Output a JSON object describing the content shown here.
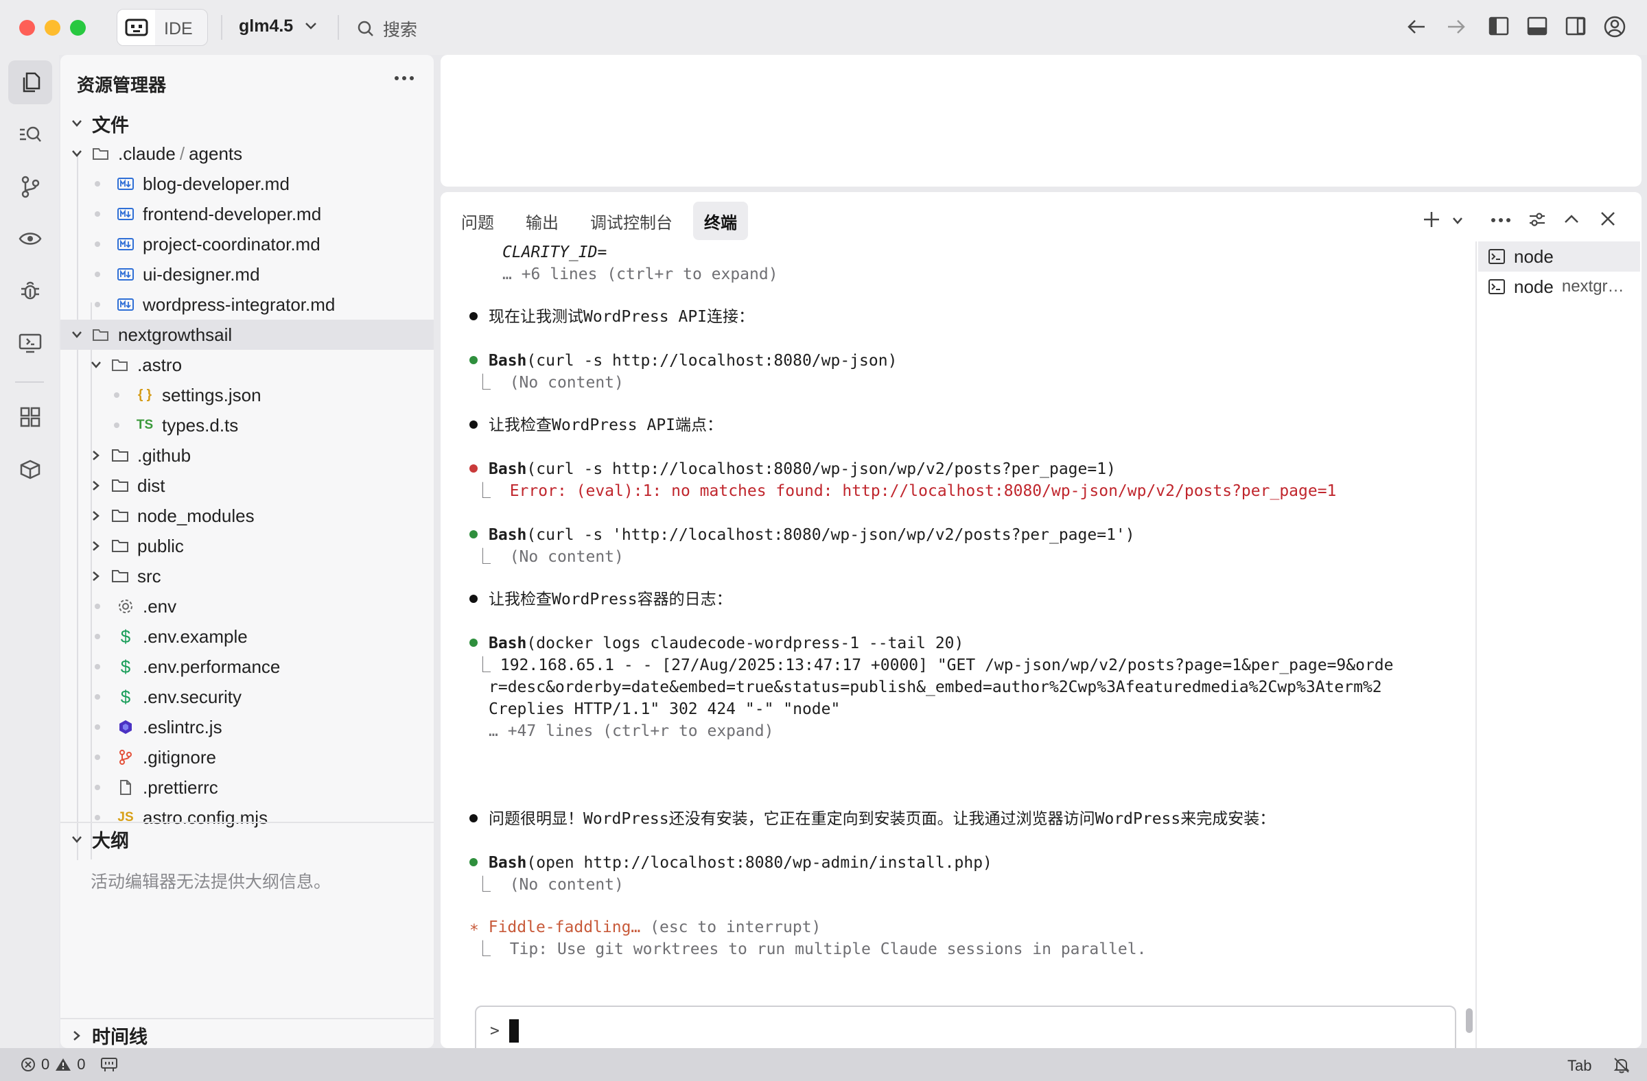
{
  "titlebar": {
    "ide_label": "IDE",
    "model": "glm4.5",
    "search_label": "搜索"
  },
  "explorer": {
    "title": "资源管理器",
    "files_section": "文件",
    "tree": [
      {
        "label": ".claude",
        "label2": "agents",
        "kind": "folder-open"
      },
      {
        "label": "blog-developer.md",
        "kind": "md"
      },
      {
        "label": "frontend-developer.md",
        "kind": "md"
      },
      {
        "label": "project-coordinator.md",
        "kind": "md"
      },
      {
        "label": "ui-designer.md",
        "kind": "md"
      },
      {
        "label": "wordpress-integrator.md",
        "kind": "md"
      },
      {
        "label": "nextgrowthsail",
        "kind": "folder-open",
        "selected": true
      },
      {
        "label": ".astro",
        "kind": "folder-open"
      },
      {
        "label": "settings.json",
        "kind": "json",
        "icon_text": "{ }"
      },
      {
        "label": "types.d.ts",
        "kind": "ts",
        "icon_text": "TS"
      },
      {
        "label": ".github",
        "kind": "folder"
      },
      {
        "label": "dist",
        "kind": "folder"
      },
      {
        "label": "node_modules",
        "kind": "folder"
      },
      {
        "label": "public",
        "kind": "folder"
      },
      {
        "label": "src",
        "kind": "folder"
      },
      {
        "label": ".env",
        "kind": "gear"
      },
      {
        "label": ".env.example",
        "kind": "dollar",
        "icon_text": "$"
      },
      {
        "label": ".env.performance",
        "kind": "dollar",
        "icon_text": "$"
      },
      {
        "label": ".env.security",
        "kind": "dollar",
        "icon_text": "$"
      },
      {
        "label": ".eslintrc.js",
        "kind": "eslint"
      },
      {
        "label": ".gitignore",
        "kind": "git"
      },
      {
        "label": ".prettierrc",
        "kind": "file"
      },
      {
        "label": "astro.config.mjs",
        "kind": "js",
        "icon_text": "JS"
      }
    ],
    "outline_title": "大纲",
    "outline_message": "活动编辑器无法提供大纲信息。",
    "timeline_title": "时间线"
  },
  "panel": {
    "tabs": [
      "问题",
      "输出",
      "调试控制台",
      "终端"
    ],
    "active_tab": "终端",
    "terminals": [
      {
        "label": "node",
        "sub": ""
      },
      {
        "label": "node",
        "sub": "nextgr…"
      }
    ],
    "terminal_lines": {
      "l1": "CLARITY_ID=",
      "l2": "… +6 lines (ctrl+r to expand)",
      "l3": "现在让我测试WordPress API连接：",
      "l4_cmd": "Bash",
      "l4_arg": "(curl -s http://localhost:8080/wp-json)",
      "l5": "(No content)",
      "l6": "让我检查WordPress API端点：",
      "l7_cmd": "Bash",
      "l7_arg": "(curl -s http://localhost:8080/wp-json/wp/v2/posts?per_page=1)",
      "l8": "Error: (eval):1: no matches found: http://localhost:8080/wp-json/wp/v2/posts?per_page=1",
      "l9_cmd": "Bash",
      "l9_arg": "(curl -s 'http://localhost:8080/wp-json/wp/v2/posts?per_page=1')",
      "l10": "(No content)",
      "l11": "让我检查WordPress容器的日志：",
      "l12_cmd": "Bash",
      "l12_arg": "(docker logs claudecode-wordpress-1 --tail 20)",
      "l13": "192.168.65.1 - - [27/Aug/2025:13:47:17 +0000] \"GET /wp-json/wp/v2/posts?page=1&per_page=9&orde",
      "l14": "r=desc&orderby=date&embed=true&status=publish&_embed=author%2Cwp%3Afeaturedmedia%2Cwp%3Aterm%2",
      "l15": "Creplies HTTP/1.1\" 302 424 \"-\" \"node\"",
      "l16": "… +47 lines (ctrl+r to expand)",
      "l17": "问题很明显！WordPress还没有安装，它正在重定向到安装页面。让我通过浏览器访问WordPress来完成安装：",
      "l18_cmd": "Bash",
      "l18_arg": "(open http://localhost:8080/wp-admin/install.php)",
      "l19": "(No content)",
      "l20_star": "∗",
      "l20_text": "Fiddle-faddling…",
      "l20_hint": "(esc to interrupt)",
      "l21": "Tip: Use git worktrees to run multiple Claude sessions in parallel."
    },
    "prompt": ">"
  },
  "statusbar": {
    "errors": "0",
    "warnings": "0",
    "tab_label": "Tab"
  },
  "colors": {
    "accent_red": "#c0262d",
    "green_bullet": "#2f8f3d",
    "red_bullet": "#c93a3a",
    "spinner": "#c85a3a"
  }
}
